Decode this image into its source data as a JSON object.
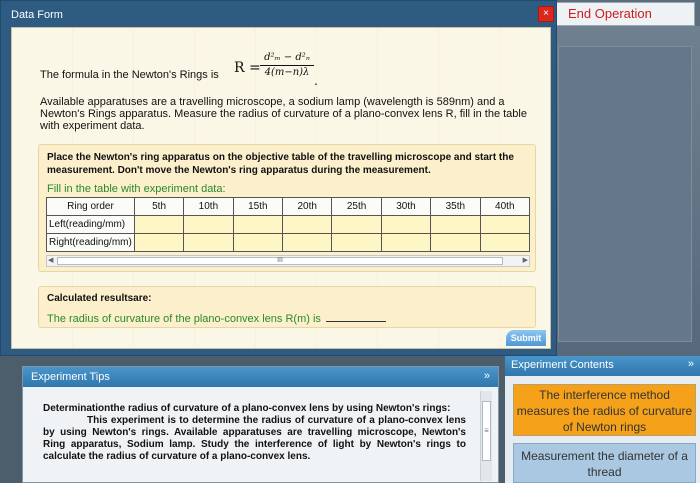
{
  "app": {
    "end_operation": "End Operation"
  },
  "dialog": {
    "title": "Data Form",
    "close_glyph": "×",
    "formula_prefix": "The formula in the Newton's Rings is",
    "formula_lhs": "R =",
    "formula_num": "d²ₘ − d²ₙ",
    "formula_den": "4(m−n)λ",
    "formula_end": ".",
    "description": "Available apparatuses are a travelling microscope, a sodium lamp (wavelength is 589nm) and a Newton's Rings apparatus. Measure the radius of curvature of a plano-convex lens R, fill in the table with experiment data.",
    "instruction": "Place the Newton's ring apparatus on the objective table of the travelling microscope and start the measurement. Don't move the Newton's ring apparatus during the measurement.",
    "fill_label": "Fill in the table with experiment data:",
    "table": {
      "header_label": "Ring order",
      "columns": [
        "5th",
        "10th",
        "15th",
        "20th",
        "25th",
        "30th",
        "35th",
        "40th"
      ],
      "rows": [
        "Left(reading/mm)",
        "Right(reading/mm)"
      ]
    },
    "scroll_grip": "III",
    "calc_label": "Calculated resultsare:",
    "result_text": "The radius of curvature of the plano-convex lens R(m) is",
    "submit_label": "Submit"
  },
  "tips": {
    "title": "Experiment Tips",
    "heading": "Determinationthe radius of curvature of a plano-convex lens by using Newton's rings:",
    "body": "This experiment is to determine the radius of curvature of a plano-convex lens by using Newton's rings. Available apparatuses are travelling microscope, Newton's Ring apparatus, Sodium lamp. Study the interference of light by Newton's rings to calculate the radius of curvature of a plano-convex lens.",
    "scroll_grip": "≡"
  },
  "contents": {
    "title": "Experiment Contents",
    "items": [
      "The interference method measures the radius of curvature of Newton rings",
      "Measurement the diameter of a thread"
    ]
  },
  "colors": {
    "title_bar": "#2d5b82",
    "panel_header": "#3a86bd",
    "active_item": "#f5a11a",
    "inactive_item": "#aac8e2",
    "green_text": "#2a8a2a",
    "close_red": "#d9291e"
  }
}
